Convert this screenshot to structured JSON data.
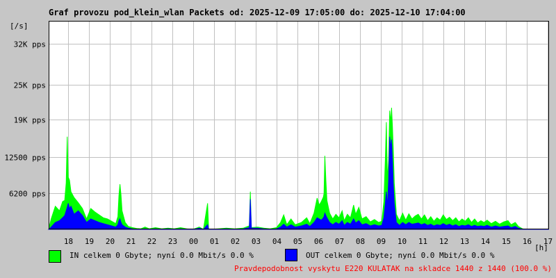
{
  "title": "Graf provozu pod_klein_wlan Packets od: 2025-12-09 17:05:00 do: 2025-12-10 17:04:00",
  "unit_label": "[/s]",
  "x_unit_label": "[h]",
  "colors": {
    "in": "#00ff00",
    "out": "#0000ff",
    "plot_bg": "#ffffff",
    "grid": "#c0c0c0",
    "page_bg": "#c6c6c6",
    "footer_text": "#ff0000"
  },
  "legend": {
    "in": {
      "label": "IN celkem 0 Gbyte; nyní   0.0 Mbit/s 0.0 %"
    },
    "out": {
      "label": "OUT celkem 0 Gbyte; nyní   0.0 Mbit/s 0.0 %"
    }
  },
  "footer": "Pravdepodobnost vyskytu E220 KULATAK na skladce 1440 z 1440 (100.0 %)",
  "chart_data": {
    "type": "area",
    "title": "Graf provozu pod_klein_wlan Packets od: 2025-12-09 17:05:00 do: 2025-12-10 17:04:00",
    "ylabel": "[/s]",
    "xlabel": "[h]",
    "ylim": [
      0,
      36000
    ],
    "yticks": [
      {
        "value": 6200,
        "label": "6200 pps"
      },
      {
        "value": 12500,
        "label": "12500 pps"
      },
      {
        "value": 19000,
        "label": "19K pps"
      },
      {
        "value": 25000,
        "label": "25K pps"
      },
      {
        "value": 32000,
        "label": "32K pps"
      }
    ],
    "xlim": [
      17.08,
      41.07
    ],
    "xticks": [
      {
        "value": 18,
        "label": "18"
      },
      {
        "value": 19,
        "label": "19"
      },
      {
        "value": 20,
        "label": "20"
      },
      {
        "value": 21,
        "label": "21"
      },
      {
        "value": 22,
        "label": "22"
      },
      {
        "value": 23,
        "label": "23"
      },
      {
        "value": 24,
        "label": "00"
      },
      {
        "value": 25,
        "label": "01"
      },
      {
        "value": 26,
        "label": "02"
      },
      {
        "value": 27,
        "label": "03"
      },
      {
        "value": 28,
        "label": "04"
      },
      {
        "value": 29,
        "label": "05"
      },
      {
        "value": 30,
        "label": "06"
      },
      {
        "value": 31,
        "label": "07"
      },
      {
        "value": 32,
        "label": "08"
      },
      {
        "value": 33,
        "label": "09"
      },
      {
        "value": 34,
        "label": "10"
      },
      {
        "value": 35,
        "label": "11"
      },
      {
        "value": 36,
        "label": "12"
      },
      {
        "value": 37,
        "label": "13"
      },
      {
        "value": 38,
        "label": "14"
      },
      {
        "value": 39,
        "label": "15"
      },
      {
        "value": 40,
        "label": "16"
      },
      {
        "value": 41,
        "label": "17"
      }
    ],
    "grid": true,
    "series": [
      {
        "name": "IN",
        "points": [
          [
            17.08,
            0
          ],
          [
            17.2,
            1800
          ],
          [
            17.4,
            4000
          ],
          [
            17.6,
            3200
          ],
          [
            17.75,
            4800
          ],
          [
            17.85,
            5000
          ],
          [
            17.92,
            8000
          ],
          [
            17.97,
            16000
          ],
          [
            18.02,
            9000
          ],
          [
            18.08,
            8500
          ],
          [
            18.15,
            6500
          ],
          [
            18.3,
            5500
          ],
          [
            18.5,
            4600
          ],
          [
            18.7,
            3600
          ],
          [
            18.9,
            1800
          ],
          [
            19.1,
            3600
          ],
          [
            19.3,
            3000
          ],
          [
            19.5,
            2500
          ],
          [
            19.7,
            2000
          ],
          [
            19.9,
            1800
          ],
          [
            20.1,
            1400
          ],
          [
            20.3,
            1000
          ],
          [
            20.4,
            2200
          ],
          [
            20.45,
            5800
          ],
          [
            20.5,
            7800
          ],
          [
            20.55,
            6000
          ],
          [
            20.6,
            3200
          ],
          [
            20.75,
            1200
          ],
          [
            20.9,
            500
          ],
          [
            21.1,
            300
          ],
          [
            21.3,
            150
          ],
          [
            21.5,
            100
          ],
          [
            21.7,
            400
          ],
          [
            21.9,
            100
          ],
          [
            22.2,
            300
          ],
          [
            22.5,
            100
          ],
          [
            22.8,
            200
          ],
          [
            23.1,
            100
          ],
          [
            23.4,
            300
          ],
          [
            23.7,
            100
          ],
          [
            24.0,
            0
          ],
          [
            24.3,
            400
          ],
          [
            24.5,
            0
          ],
          [
            24.7,
            4500
          ],
          [
            24.75,
            0
          ],
          [
            25.2,
            100
          ],
          [
            25.6,
            200
          ],
          [
            26.0,
            100
          ],
          [
            26.4,
            200
          ],
          [
            26.7,
            600
          ],
          [
            26.75,
            6500
          ],
          [
            26.8,
            300
          ],
          [
            27.1,
            400
          ],
          [
            27.4,
            200
          ],
          [
            27.7,
            100
          ],
          [
            28.0,
            300
          ],
          [
            28.2,
            1200
          ],
          [
            28.35,
            2500
          ],
          [
            28.5,
            800
          ],
          [
            28.7,
            1800
          ],
          [
            28.9,
            800
          ],
          [
            29.2,
            1200
          ],
          [
            29.45,
            2000
          ],
          [
            29.6,
            1000
          ],
          [
            29.8,
            2800
          ],
          [
            29.95,
            5400
          ],
          [
            30.05,
            4200
          ],
          [
            30.15,
            4800
          ],
          [
            30.25,
            5600
          ],
          [
            30.28,
            6200
          ],
          [
            30.32,
            12700
          ],
          [
            30.37,
            8500
          ],
          [
            30.42,
            5000
          ],
          [
            30.55,
            2800
          ],
          [
            30.7,
            1800
          ],
          [
            30.85,
            2600
          ],
          [
            31.0,
            2000
          ],
          [
            31.15,
            3200
          ],
          [
            31.25,
            1500
          ],
          [
            31.4,
            2600
          ],
          [
            31.55,
            2000
          ],
          [
            31.7,
            4200
          ],
          [
            31.8,
            2600
          ],
          [
            31.95,
            3800
          ],
          [
            32.1,
            1800
          ],
          [
            32.3,
            2200
          ],
          [
            32.5,
            1300
          ],
          [
            32.7,
            1700
          ],
          [
            32.9,
            1200
          ],
          [
            33.05,
            1400
          ],
          [
            33.15,
            4800
          ],
          [
            33.22,
            12000
          ],
          [
            33.27,
            18500
          ],
          [
            33.32,
            8500
          ],
          [
            33.38,
            12000
          ],
          [
            33.43,
            20500
          ],
          [
            33.48,
            18500
          ],
          [
            33.52,
            21000
          ],
          [
            33.56,
            18000
          ],
          [
            33.6,
            14000
          ],
          [
            33.65,
            8000
          ],
          [
            33.75,
            2600
          ],
          [
            33.9,
            1500
          ],
          [
            34.05,
            2800
          ],
          [
            34.2,
            1600
          ],
          [
            34.35,
            2700
          ],
          [
            34.5,
            1800
          ],
          [
            34.65,
            2300
          ],
          [
            34.8,
            2600
          ],
          [
            34.95,
            1800
          ],
          [
            35.1,
            2500
          ],
          [
            35.25,
            1500
          ],
          [
            35.4,
            2200
          ],
          [
            35.55,
            1400
          ],
          [
            35.7,
            2000
          ],
          [
            35.85,
            1600
          ],
          [
            36.0,
            2500
          ],
          [
            36.15,
            1700
          ],
          [
            36.3,
            2100
          ],
          [
            36.45,
            1500
          ],
          [
            36.6,
            2000
          ],
          [
            36.75,
            1300
          ],
          [
            36.9,
            1800
          ],
          [
            37.05,
            1400
          ],
          [
            37.2,
            2000
          ],
          [
            37.35,
            1200
          ],
          [
            37.5,
            1800
          ],
          [
            37.65,
            1100
          ],
          [
            37.8,
            1500
          ],
          [
            37.95,
            1200
          ],
          [
            38.1,
            1600
          ],
          [
            38.3,
            1000
          ],
          [
            38.5,
            1400
          ],
          [
            38.7,
            900
          ],
          [
            38.9,
            1300
          ],
          [
            39.1,
            1500
          ],
          [
            39.25,
            800
          ],
          [
            39.45,
            1200
          ],
          [
            39.6,
            500
          ],
          [
            39.8,
            100
          ],
          [
            40.0,
            0
          ],
          [
            41.07,
            0
          ]
        ]
      },
      {
        "name": "OUT",
        "points": [
          [
            17.08,
            0
          ],
          [
            17.2,
            400
          ],
          [
            17.4,
            1200
          ],
          [
            17.6,
            1500
          ],
          [
            17.75,
            2000
          ],
          [
            17.85,
            2400
          ],
          [
            17.92,
            3200
          ],
          [
            17.97,
            3800
          ],
          [
            18.02,
            4500
          ],
          [
            18.08,
            3600
          ],
          [
            18.15,
            4000
          ],
          [
            18.3,
            2600
          ],
          [
            18.5,
            3200
          ],
          [
            18.7,
            2400
          ],
          [
            18.9,
            1200
          ],
          [
            19.1,
            1800
          ],
          [
            19.3,
            1500
          ],
          [
            19.5,
            1200
          ],
          [
            19.7,
            1000
          ],
          [
            19.9,
            800
          ],
          [
            20.1,
            600
          ],
          [
            20.3,
            400
          ],
          [
            20.4,
            800
          ],
          [
            20.45,
            1500
          ],
          [
            20.5,
            1800
          ],
          [
            20.55,
            1200
          ],
          [
            20.6,
            800
          ],
          [
            20.75,
            400
          ],
          [
            20.9,
            200
          ],
          [
            21.1,
            100
          ],
          [
            21.3,
            50
          ],
          [
            21.5,
            50
          ],
          [
            21.7,
            100
          ],
          [
            21.9,
            50
          ],
          [
            22.2,
            100
          ],
          [
            22.5,
            50
          ],
          [
            22.8,
            100
          ],
          [
            23.1,
            50
          ],
          [
            23.4,
            100
          ],
          [
            23.7,
            50
          ],
          [
            24.0,
            0
          ],
          [
            24.3,
            200
          ],
          [
            24.5,
            0
          ],
          [
            24.7,
            800
          ],
          [
            24.75,
            0
          ],
          [
            25.2,
            50
          ],
          [
            25.6,
            100
          ],
          [
            26.0,
            50
          ],
          [
            26.4,
            100
          ],
          [
            26.7,
            300
          ],
          [
            26.75,
            5200
          ],
          [
            26.8,
            200
          ],
          [
            27.1,
            200
          ],
          [
            27.4,
            100
          ],
          [
            27.7,
            50
          ],
          [
            28.0,
            100
          ],
          [
            28.2,
            400
          ],
          [
            28.35,
            900
          ],
          [
            28.5,
            400
          ],
          [
            28.7,
            800
          ],
          [
            28.9,
            400
          ],
          [
            29.2,
            600
          ],
          [
            29.45,
            900
          ],
          [
            29.6,
            500
          ],
          [
            29.8,
            1200
          ],
          [
            29.95,
            2000
          ],
          [
            30.05,
            1800
          ],
          [
            30.15,
            1600
          ],
          [
            30.25,
            2000
          ],
          [
            30.28,
            2200
          ],
          [
            30.32,
            2800
          ],
          [
            30.37,
            2400
          ],
          [
            30.42,
            2000
          ],
          [
            30.55,
            1200
          ],
          [
            30.7,
            800
          ],
          [
            30.85,
            1200
          ],
          [
            31.0,
            900
          ],
          [
            31.15,
            1500
          ],
          [
            31.25,
            700
          ],
          [
            31.4,
            1200
          ],
          [
            31.55,
            900
          ],
          [
            31.7,
            1800
          ],
          [
            31.8,
            1100
          ],
          [
            31.95,
            1500
          ],
          [
            32.1,
            800
          ],
          [
            32.3,
            1000
          ],
          [
            32.5,
            600
          ],
          [
            32.7,
            800
          ],
          [
            32.9,
            600
          ],
          [
            33.05,
            700
          ],
          [
            33.15,
            2000
          ],
          [
            33.22,
            4500
          ],
          [
            33.27,
            6500
          ],
          [
            33.32,
            4000
          ],
          [
            33.38,
            8500
          ],
          [
            33.43,
            16000
          ],
          [
            33.48,
            14000
          ],
          [
            33.52,
            15500
          ],
          [
            33.56,
            12000
          ],
          [
            33.6,
            8000
          ],
          [
            33.65,
            4500
          ],
          [
            33.75,
            1200
          ],
          [
            33.9,
            700
          ],
          [
            34.05,
            1200
          ],
          [
            34.2,
            800
          ],
          [
            34.35,
            1200
          ],
          [
            34.5,
            900
          ],
          [
            34.65,
            1000
          ],
          [
            34.8,
            1100
          ],
          [
            34.95,
            800
          ],
          [
            35.1,
            1000
          ],
          [
            35.25,
            700
          ],
          [
            35.4,
            900
          ],
          [
            35.55,
            600
          ],
          [
            35.7,
            800
          ],
          [
            35.85,
            700
          ],
          [
            36.0,
            1000
          ],
          [
            36.15,
            700
          ],
          [
            36.3,
            900
          ],
          [
            36.45,
            600
          ],
          [
            36.6,
            800
          ],
          [
            36.75,
            500
          ],
          [
            36.9,
            700
          ],
          [
            37.05,
            600
          ],
          [
            37.2,
            800
          ],
          [
            37.35,
            500
          ],
          [
            37.5,
            700
          ],
          [
            37.65,
            500
          ],
          [
            37.8,
            600
          ],
          [
            37.95,
            500
          ],
          [
            38.1,
            700
          ],
          [
            38.3,
            400
          ],
          [
            38.5,
            600
          ],
          [
            38.7,
            400
          ],
          [
            38.9,
            500
          ],
          [
            39.1,
            600
          ],
          [
            39.25,
            300
          ],
          [
            39.45,
            500
          ],
          [
            39.6,
            200
          ],
          [
            39.8,
            50
          ],
          [
            40.0,
            0
          ],
          [
            41.07,
            0
          ]
        ]
      }
    ]
  }
}
